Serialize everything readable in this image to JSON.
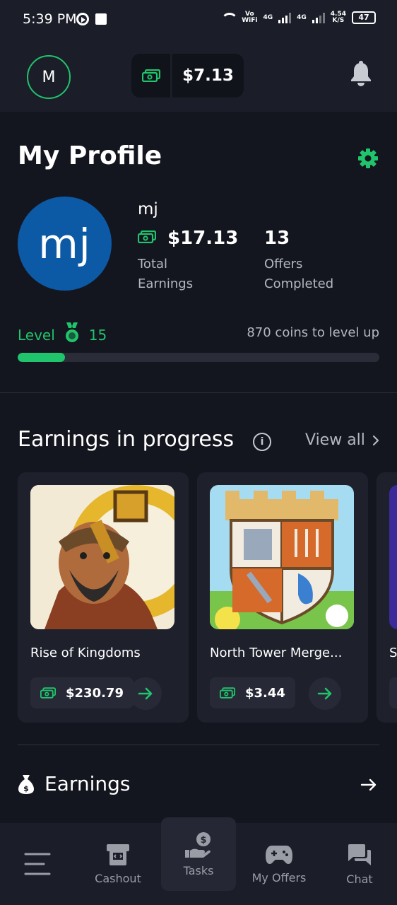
{
  "status_bar": {
    "time": "5:39 PM",
    "network_top": "Vo",
    "network_bottom": "WiFi",
    "sig1": "4G",
    "sig2": "4G",
    "speed_top": "4.54",
    "speed_bottom": "K/S",
    "battery": "47"
  },
  "header": {
    "avatar_initial": "M",
    "balance": "$7.13",
    "icons": [
      "cash-icon",
      "bell-icon"
    ]
  },
  "profile": {
    "title": "My Profile",
    "avatar_text": "mj",
    "username": "mj",
    "total_earnings": "$17.13",
    "total_earnings_label_1": "Total",
    "total_earnings_label_2": "Earnings",
    "offers_completed": "13",
    "offers_label_1": "Offers",
    "offers_label_2": "Completed",
    "level_label": "Level",
    "level_value": "15",
    "coins_to_level": "870 coins to level up",
    "level_progress_fraction": 0.13
  },
  "earnings_in_progress": {
    "title": "Earnings in progress",
    "view_all": "View all",
    "cards": [
      {
        "name": "Rise of Kingdoms",
        "amount": "$230.79"
      },
      {
        "name": "North Tower Merge...",
        "amount": "$3.44"
      },
      {
        "name": "S",
        "amount": ""
      }
    ]
  },
  "earnings_section": {
    "title": "Earnings"
  },
  "bottom_nav": {
    "items": [
      {
        "label": "",
        "icon": "menu-icon"
      },
      {
        "label": "Cashout",
        "icon": "cashout-icon"
      },
      {
        "label": "Tasks",
        "icon": "tasks-icon"
      },
      {
        "label": "My Offers",
        "icon": "gamepad-icon"
      },
      {
        "label": "Chat",
        "icon": "chat-icon"
      }
    ],
    "active": "Tasks"
  },
  "colors": {
    "accent": "#20c46c",
    "background": "#14161f",
    "surface": "#1b1e29",
    "card": "#1e212c",
    "profile_pic": "#0c5aa5"
  }
}
